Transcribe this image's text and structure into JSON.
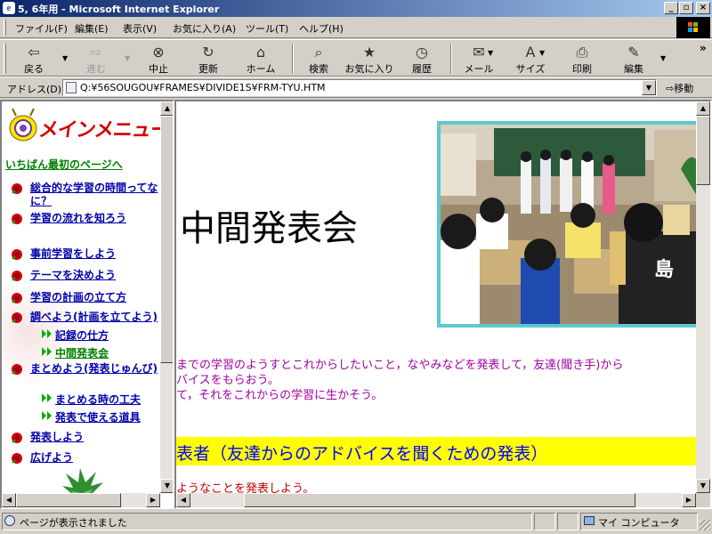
{
  "window": {
    "title": "5, 6年用 - Microsoft Internet Explorer",
    "minimize": "_",
    "maximize": "▫",
    "close": "×"
  },
  "menu": [
    "ファイル(F)",
    "編集(E)",
    "表示(V)",
    "お気に入り(A)",
    "ツール(T)",
    "ヘルプ(H)"
  ],
  "toolbar": {
    "back": "戻る",
    "forward": "進む",
    "stop": "中止",
    "refresh": "更新",
    "home": "ホーム",
    "search": "検索",
    "favorites": "お気に入り",
    "history": "履歴",
    "mail": "メール",
    "size": "サイズ",
    "print": "印刷",
    "edit": "編集",
    "more": "»"
  },
  "address": {
    "label": "アドレス(D)",
    "url": "Q:¥56SOUGOU¥FRAMES¥DIVIDE1S¥FRM-TYU.HTM",
    "go": "移動"
  },
  "left": {
    "title": "メインメニュー",
    "top_link": "いちばん最初のページへ",
    "items": [
      {
        "label": "総合的な学習の時間ってなに？"
      },
      {
        "label": "学習の流れを知ろう"
      },
      {
        "label": "事前学習をしよう"
      },
      {
        "label": "テーマを決めよう"
      },
      {
        "label": "学習の計画の立て方"
      },
      {
        "label": "調べよう(計画を立てよう)"
      },
      {
        "label": "まとめよう(発表じゅんび)"
      },
      {
        "label": "発表しよう"
      },
      {
        "label": "広げよう"
      }
    ],
    "sub_a": [
      {
        "label": "記録の仕方"
      },
      {
        "label": "中間発表会"
      }
    ],
    "sub_b": [
      {
        "label": "まとめる時の工夫"
      },
      {
        "label": "発表で使える道具"
      }
    ]
  },
  "main": {
    "heading": "中間発表会",
    "purple_lines": [
      "までの学習のようすとこれからしたいこと，なやみなどを発表して，友達(聞き手)から",
      "バイスをもらおう。",
      "て，それをこれからの学習に生かそう。"
    ],
    "banner": "表者（友達からのアドバイスを聞くための発表）",
    "red_line": "ようなことを発表しよう。"
  },
  "status": {
    "text": "ページが表示されました",
    "zone": "マイ コンピュータ"
  },
  "colors": {
    "title_start": "#0a246a",
    "title_end": "#a6caf0",
    "menu_title": "#d40000",
    "link": "#0000aa",
    "green_link": "#008000",
    "purple_text": "#a000a0",
    "banner_bg": "#ffff00",
    "banner_text": "#0000ff",
    "red_text": "#c00000",
    "photo_frame": "#5cc8cf"
  }
}
